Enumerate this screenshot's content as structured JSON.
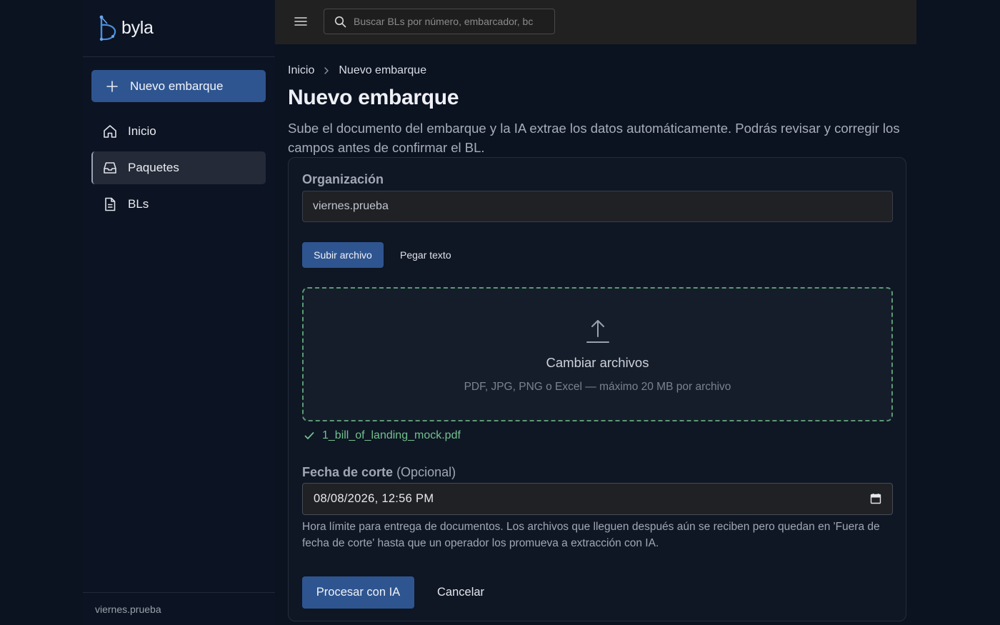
{
  "app": {
    "name": "byla"
  },
  "sidebar": {
    "new_button": "Nuevo embarque",
    "items": [
      {
        "label": "Inicio",
        "icon": "home-icon",
        "active": false
      },
      {
        "label": "Paquetes",
        "icon": "inbox-icon",
        "active": true
      },
      {
        "label": "BLs",
        "icon": "document-icon",
        "active": false
      }
    ],
    "footer_org": "viernes.prueba"
  },
  "topbar": {
    "search_placeholder": "Buscar BLs por número, embarcador, bc"
  },
  "breadcrumb": {
    "home": "Inicio",
    "current": "Nuevo embarque"
  },
  "page": {
    "title": "Nuevo embarque",
    "description": "Sube el documento del embarque y la IA extrae los datos automáticamente. Podrás revisar y corregir los campos antes de confirmar el BL."
  },
  "form": {
    "org_label": "Organización",
    "org_value": "viernes.prueba",
    "tabs": {
      "upload": "Subir archivo",
      "paste": "Pegar texto"
    },
    "dropzone": {
      "title": "Cambiar archivos",
      "subtitle": "PDF, JPG, PNG o Excel — máximo 20 MB por archivo"
    },
    "uploaded_file": "1_bill_of_landing_mock.pdf",
    "date_label": "Fecha de corte",
    "date_optional": "(Opcional)",
    "date_value": "08/08/2026, 12:56 PM",
    "date_hint": "Hora límite para entrega de documentos. Los archivos que lleguen después aún se reciben pero quedan en 'Fuera de fecha de corte' hasta que un operador los promueva a extracción con IA.",
    "process_button": "Procesar con IA",
    "cancel_button": "Cancelar"
  },
  "colors": {
    "accent": "#2f5590",
    "success": "#73c08e",
    "dropzone_border": "#5c9a73"
  }
}
